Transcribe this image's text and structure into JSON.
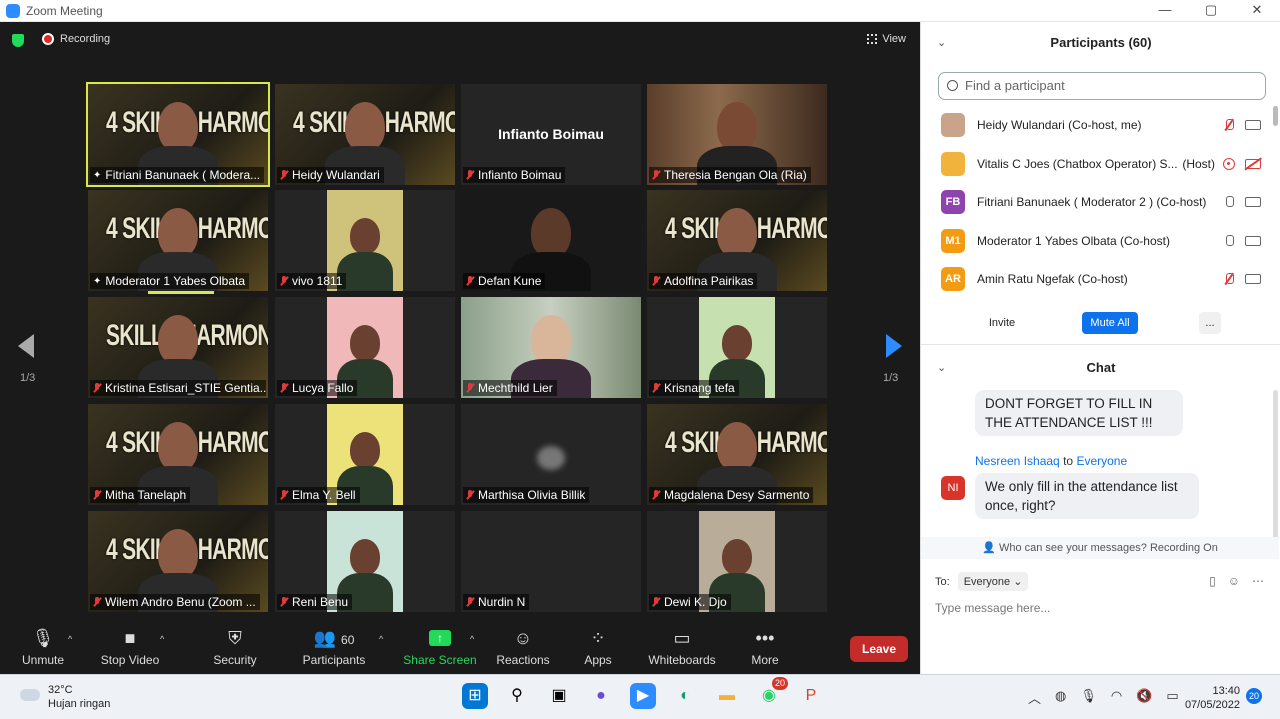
{
  "window": {
    "title": "Zoom Meeting",
    "controls": [
      "—",
      "▢",
      "✕"
    ]
  },
  "meeting": {
    "recording_label": "Recording",
    "view_label": "View",
    "page_left": "1/3",
    "page_right": "1/3"
  },
  "tiles": [
    {
      "name": "Fitriani Banunaek ( Modera...",
      "style": "banner",
      "banner": "4 SKILLS HARMONY",
      "active": true,
      "muted": false
    },
    {
      "name": "Heidy Wulandari",
      "style": "banner",
      "banner": "4 SKILLS HARMONY",
      "muted": true
    },
    {
      "name": "Infianto Boimau",
      "style": "noname",
      "center": "Infianto Boimau",
      "muted": true
    },
    {
      "name": "Theresia Bengan Ola (Ria)",
      "style": "room",
      "muted": true
    },
    {
      "name": "Moderator 1 Yabes Olbata",
      "style": "banner",
      "banner": "4 SKILLS HARMONY",
      "muted": false
    },
    {
      "name": "vivo 1811",
      "style": "narrow",
      "muted": true
    },
    {
      "name": "Defan Kune",
      "style": "dark",
      "muted": true
    },
    {
      "name": "Adolfina Pairikas",
      "style": "banner",
      "banner": "4 SKILLS HARMONY",
      "muted": true
    },
    {
      "name": "Kristina Estisari_STIE Gentia...",
      "style": "banner",
      "banner": "SKILLS HARMONY",
      "muted": true
    },
    {
      "name": "Lucya Fallo",
      "style": "narrow-pink",
      "muted": true
    },
    {
      "name": "Mechthild Lier",
      "style": "room-light",
      "muted": true
    },
    {
      "name": "Krisnang tefa",
      "style": "narrow-green",
      "muted": true
    },
    {
      "name": "Mitha Tanelaph",
      "style": "banner",
      "banner": "4 SKILLS HARMONY",
      "muted": true
    },
    {
      "name": "Elma Y. Bell",
      "style": "narrow-yellow",
      "muted": true
    },
    {
      "name": "Marthisa Olivia Billik",
      "style": "blurred",
      "muted": true
    },
    {
      "name": "Magdalena Desy Sarmento",
      "style": "banner",
      "banner": "4 SKILLS HARMONY",
      "muted": true
    },
    {
      "name": "Wilem Andro Benu (Zoom ...",
      "style": "banner",
      "banner": "4 SKILLS HARMONY",
      "muted": true
    },
    {
      "name": "Reni Benu",
      "style": "narrow-teal",
      "muted": true
    },
    {
      "name": "Nurdin N",
      "style": "empty",
      "muted": true
    },
    {
      "name": "Dewi K. Djo",
      "style": "narrow-stone",
      "muted": true
    }
  ],
  "toolbar": {
    "unmute": "Unmute",
    "stop_video": "Stop Video",
    "security": "Security",
    "participants": "Participants",
    "participants_count": "60",
    "share_screen": "Share Screen",
    "reactions": "Reactions",
    "apps": "Apps",
    "whiteboards": "Whiteboards",
    "more": "More",
    "leave": "Leave"
  },
  "participants_panel": {
    "title": "Participants (60)",
    "search_placeholder": "Find a participant",
    "items": [
      {
        "initials": "",
        "name": "Heidy Wulandari (Co-host, me)",
        "role": "",
        "avatar_color": "#c9a38a",
        "mic": "muted",
        "cam": "on"
      },
      {
        "initials": "",
        "name": "Vitalis C Joes (Chatbox Operator) S...",
        "role": "(Host)",
        "avatar_color": "#f2b33d",
        "mic": "rec",
        "cam": "off"
      },
      {
        "initials": "FB",
        "name": "Fitriani Banunaek ( Moderator 2 ) (Co-host)",
        "role": "",
        "avatar_color": "#8e44ad",
        "mic": "on",
        "cam": "on"
      },
      {
        "initials": "M1",
        "name": "Moderator 1 Yabes Olbata (Co-host)",
        "role": "",
        "avatar_color": "#f39c12",
        "mic": "on",
        "cam": "on"
      },
      {
        "initials": "AR",
        "name": "Amin Ratu Ngefak (Co-host)",
        "role": "",
        "avatar_color": "#f39c12",
        "mic": "muted",
        "cam": "on"
      }
    ],
    "invite": "Invite",
    "mute_all": "Mute All",
    "more": "..."
  },
  "chat": {
    "title": "Chat",
    "msg1": "DONT FORGET TO FILL IN THE ATTENDANCE LIST !!!",
    "sender": "Nesreen Ishaaq",
    "to_word": "to",
    "recipient": "Everyone",
    "sender_initials": "NI",
    "msg2": "We only fill in the attendance list once, right?",
    "notice": "Who can see your messages? Recording On",
    "to_label": "To:",
    "to_value": "Everyone",
    "placeholder": "Type message here..."
  },
  "taskbar": {
    "temp": "32°C",
    "weather": "Hujan ringan",
    "whatsapp_badge": "20",
    "time": "13:40",
    "date": "07/05/2022",
    "notifications": "20"
  }
}
